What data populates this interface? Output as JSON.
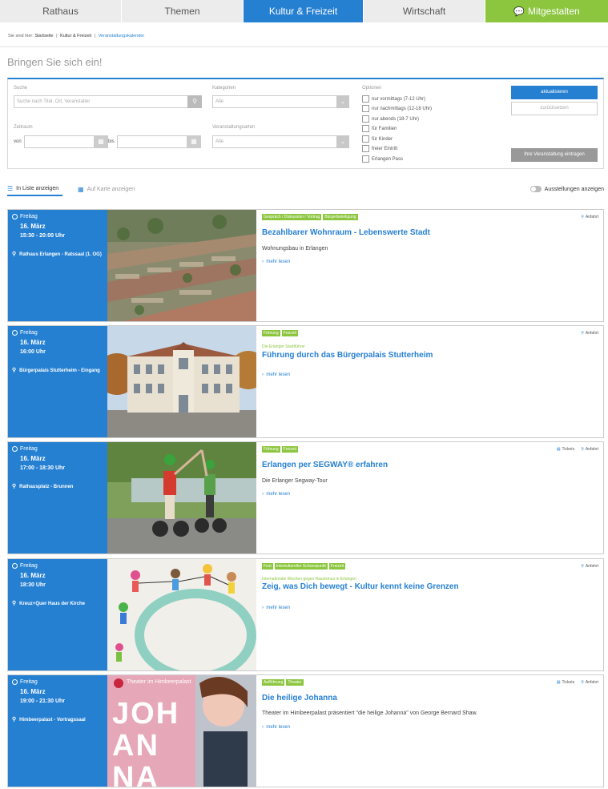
{
  "nav": {
    "tabs": [
      {
        "label": "Rathaus"
      },
      {
        "label": "Themen"
      },
      {
        "label": "Kultur & Freizeit"
      },
      {
        "label": "Wirtschaft"
      },
      {
        "label": "Mitgestalten",
        "icon": "chat-bubbles-icon"
      }
    ]
  },
  "breadcrumb": {
    "prefix": "Sie sind hier:",
    "items": [
      "Startseite",
      "Kultur & Freizeit",
      "Veranstaltungskalender"
    ],
    "sep": "|"
  },
  "headline": "Bringen Sie sich ein!",
  "filter": {
    "search_label": "Suche",
    "search_placeholder": "Suche nach Titel, Ort, Veranstalter",
    "categories_label": "Kategorien",
    "categories_value": "Alle",
    "period_label": "Zeitraum",
    "from_label": "von",
    "to_label": "bis",
    "types_label": "Veranstaltungsarten",
    "types_value": "Alle",
    "options_label": "Optionen",
    "options": [
      "nur vormittags (7-12 Uhr)",
      "nur nachmittags (12-18 Uhr)",
      "nur abends (18-7 Uhr)",
      "für Familien",
      "für Kinder",
      "freier Eintritt",
      "Erlangen Pass"
    ],
    "update_button": "aktualisieren",
    "reset_button": "zurücksetzen",
    "submit_event_button": "Ihre Veranstaltung eintragen"
  },
  "view": {
    "list_label": "In Liste anzeigen",
    "map_label": "Auf Karte anzeigen",
    "exhibitions_label": "Ausstellungen anzeigen"
  },
  "events": [
    {
      "weekday": "Freitag",
      "date": "16. März",
      "time": "15:30 - 20:00 Uhr",
      "location": "Rathaus Erlangen - Ratssaal (1. OG)",
      "tags": [
        "Gespräch / Diskussion / Vortrag",
        "Bürgerbeteiligung"
      ],
      "pre": "",
      "title": "Bezahlbarer Wohnraum - Lebenswerte Stadt",
      "subtitle": "Wohnungsbau in Erlangen",
      "tickets": "",
      "anfahrt": "Anfahrt",
      "more": "mehr lesen"
    },
    {
      "weekday": "Freitag",
      "date": "16. März",
      "time": "16:00 Uhr",
      "location": "Bürgerpalais Stutterheim - Eingang",
      "tags": [
        "Führung",
        "Freizeit"
      ],
      "pre": "Die Erlanger Stadtführer",
      "title": "Führung durch das Bürgerpalais Stutterheim",
      "subtitle": "",
      "tickets": "",
      "anfahrt": "Anfahrt",
      "more": "mehr lesen"
    },
    {
      "weekday": "Freitag",
      "date": "16. März",
      "time": "17:00 - 18:30 Uhr",
      "location": "Rathausplatz - Brunnen",
      "tags": [
        "Führung",
        "Freizeit"
      ],
      "pre": "",
      "title": "Erlangen per SEGWAY® erfahren",
      "subtitle": "Die Erlanger Segway-Tour",
      "tickets": "Tickets",
      "anfahrt": "Anfahrt",
      "more": "mehr lesen"
    },
    {
      "weekday": "Freitag",
      "date": "16. März",
      "time": "18:30 Uhr",
      "location": "Kreuz+Quer Haus der Kirche",
      "tags": [
        "Fest",
        "Interkultureller Schwerpunkt",
        "Freizeit"
      ],
      "pre": "Internationale Wochen gegen Rassismus in Erlangen",
      "title": "Zeig, was Dich bewegt - Kultur kennt keine Grenzen",
      "subtitle": "",
      "tickets": "",
      "anfahrt": "Anfahrt",
      "more": "mehr lesen"
    },
    {
      "weekday": "Freitag",
      "date": "16. März",
      "time": "19:00 - 21:30 Uhr",
      "location": "Himbeerpalast - Vortragssaal",
      "tags": [
        "Aufführung",
        "Theater"
      ],
      "pre": "",
      "title": "Die heilige Johanna",
      "subtitle": "Theater im Himbeerpalast präsentiert \"die heilige Johanna\" von George Bernard Shaw.",
      "tickets": "Tickets",
      "anfahrt": "Anfahrt",
      "more": "mehr lesen",
      "poster_brand": "Theater im Himbeerpalast",
      "poster_text": "JOH AN NA"
    }
  ],
  "colors": {
    "accent": "#2680d2",
    "green": "#8cc63f"
  }
}
